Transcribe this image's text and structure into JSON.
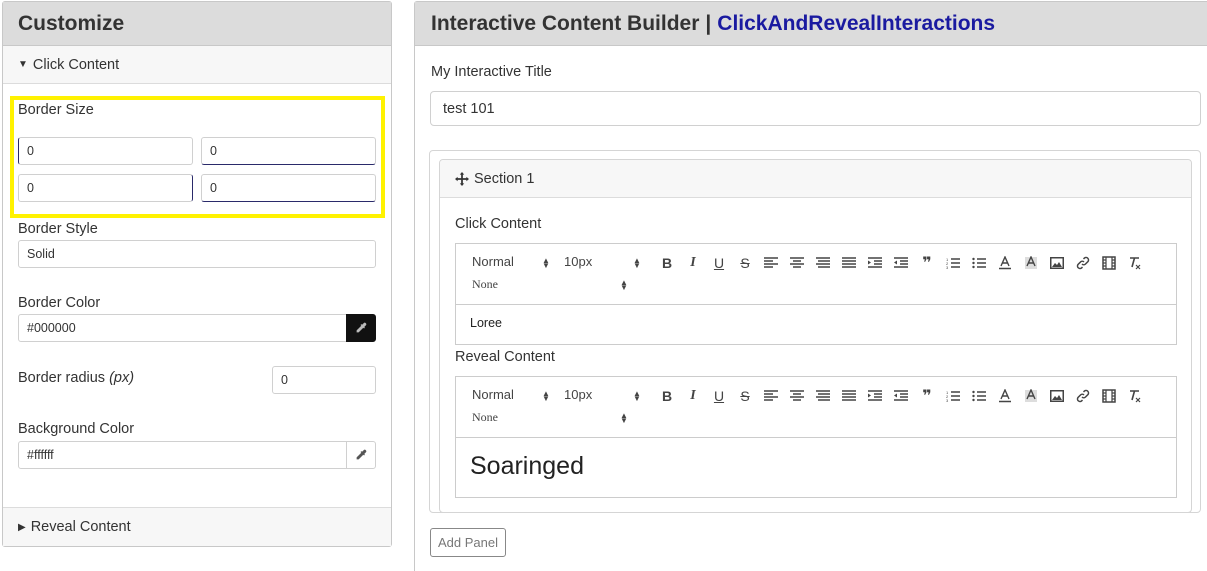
{
  "customize": {
    "title": "Customize",
    "click_content_label": "Click Content",
    "reveal_content_label": "Reveal Content",
    "border_size": {
      "label": "Border Size",
      "values": [
        "0",
        "0",
        "0",
        "0"
      ]
    },
    "border_style": {
      "label": "Border Style",
      "value": "Solid"
    },
    "border_color": {
      "label": "Border Color",
      "value": "#000000"
    },
    "border_radius": {
      "label": "Border radius",
      "unit": "(px)",
      "value": "0"
    },
    "background_color": {
      "label": "Background Color",
      "value": "#ffffff"
    }
  },
  "builder": {
    "title": "Interactive Content Builder",
    "separator": "|",
    "subtitle": "ClickAndRevealInteractions",
    "title_label": "My Interactive Title",
    "title_value": "test 101",
    "section": {
      "label": "Section 1",
      "click_content": {
        "label": "Click Content",
        "body": "Loree"
      },
      "reveal_content": {
        "label": "Reveal Content",
        "body": "Soaringed"
      }
    },
    "add_panel_label": "Add Panel"
  },
  "toolbar": {
    "header_select": "Normal",
    "size_select": "10px",
    "font_select": "None"
  },
  "colors": {
    "highlight": "#fff200",
    "header_bg": "#dcdcdc",
    "link": "#1a1aa0"
  }
}
